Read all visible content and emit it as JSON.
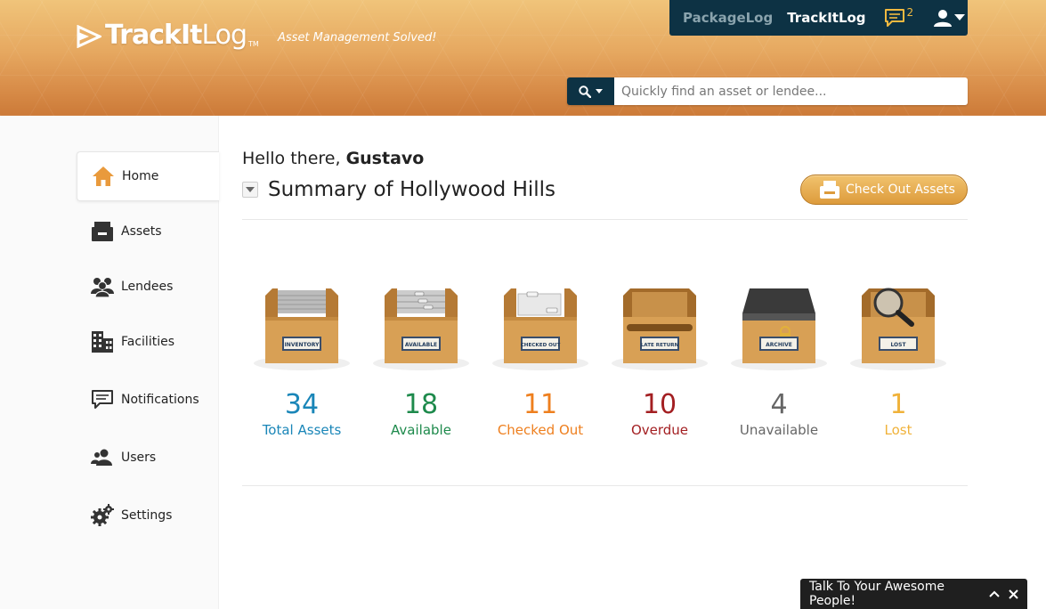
{
  "brand": {
    "name_bold": "TrackIt",
    "name_light": "Log",
    "tm": "TM",
    "tagline": "Asset Management Solved!"
  },
  "topbar": {
    "packagelog": "PackageLog",
    "trackitlog": "TrackItLog",
    "notification_count": "2"
  },
  "search": {
    "placeholder": "Quickly find an asset or lendee..."
  },
  "sidebar": {
    "items": [
      {
        "label": "Home",
        "icon": "home-icon"
      },
      {
        "label": "Assets",
        "icon": "assets-icon"
      },
      {
        "label": "Lendees",
        "icon": "lendees-icon"
      },
      {
        "label": "Facilities",
        "icon": "facilities-icon"
      },
      {
        "label": "Notifications",
        "icon": "notifications-icon"
      },
      {
        "label": "Users",
        "icon": "users-icon"
      },
      {
        "label": "Settings",
        "icon": "settings-icon"
      }
    ]
  },
  "main": {
    "greeting_prefix": "Hello there,",
    "user_name": "Gustavo",
    "summary_title": "Summary of Hollywood Hills",
    "checkout_label": "Check Out Assets"
  },
  "stats": [
    {
      "value": "34",
      "label": "Total Assets",
      "box_label": "INVENTORY",
      "color": "#1a86b8"
    },
    {
      "value": "18",
      "label": "Available",
      "box_label": "AVAILABLE",
      "color": "#1e8a4c"
    },
    {
      "value": "11",
      "label": "Checked Out",
      "box_label": "CHECKED OUT",
      "color": "#ee7f1e"
    },
    {
      "value": "10",
      "label": "Overdue",
      "box_label": "LATE RETURN",
      "color": "#a31f22"
    },
    {
      "value": "4",
      "label": "Unavailable",
      "box_label": "ARCHIVE",
      "color": "#666666"
    },
    {
      "value": "1",
      "label": "Lost",
      "box_label": "LOST",
      "color": "#f0b23a"
    }
  ],
  "chat": {
    "label": "Talk To Your Awesome People!"
  },
  "colors": {
    "navy": "#0d3244",
    "accent_orange": "#e6a860",
    "button_gold": "#dd9b3c"
  }
}
